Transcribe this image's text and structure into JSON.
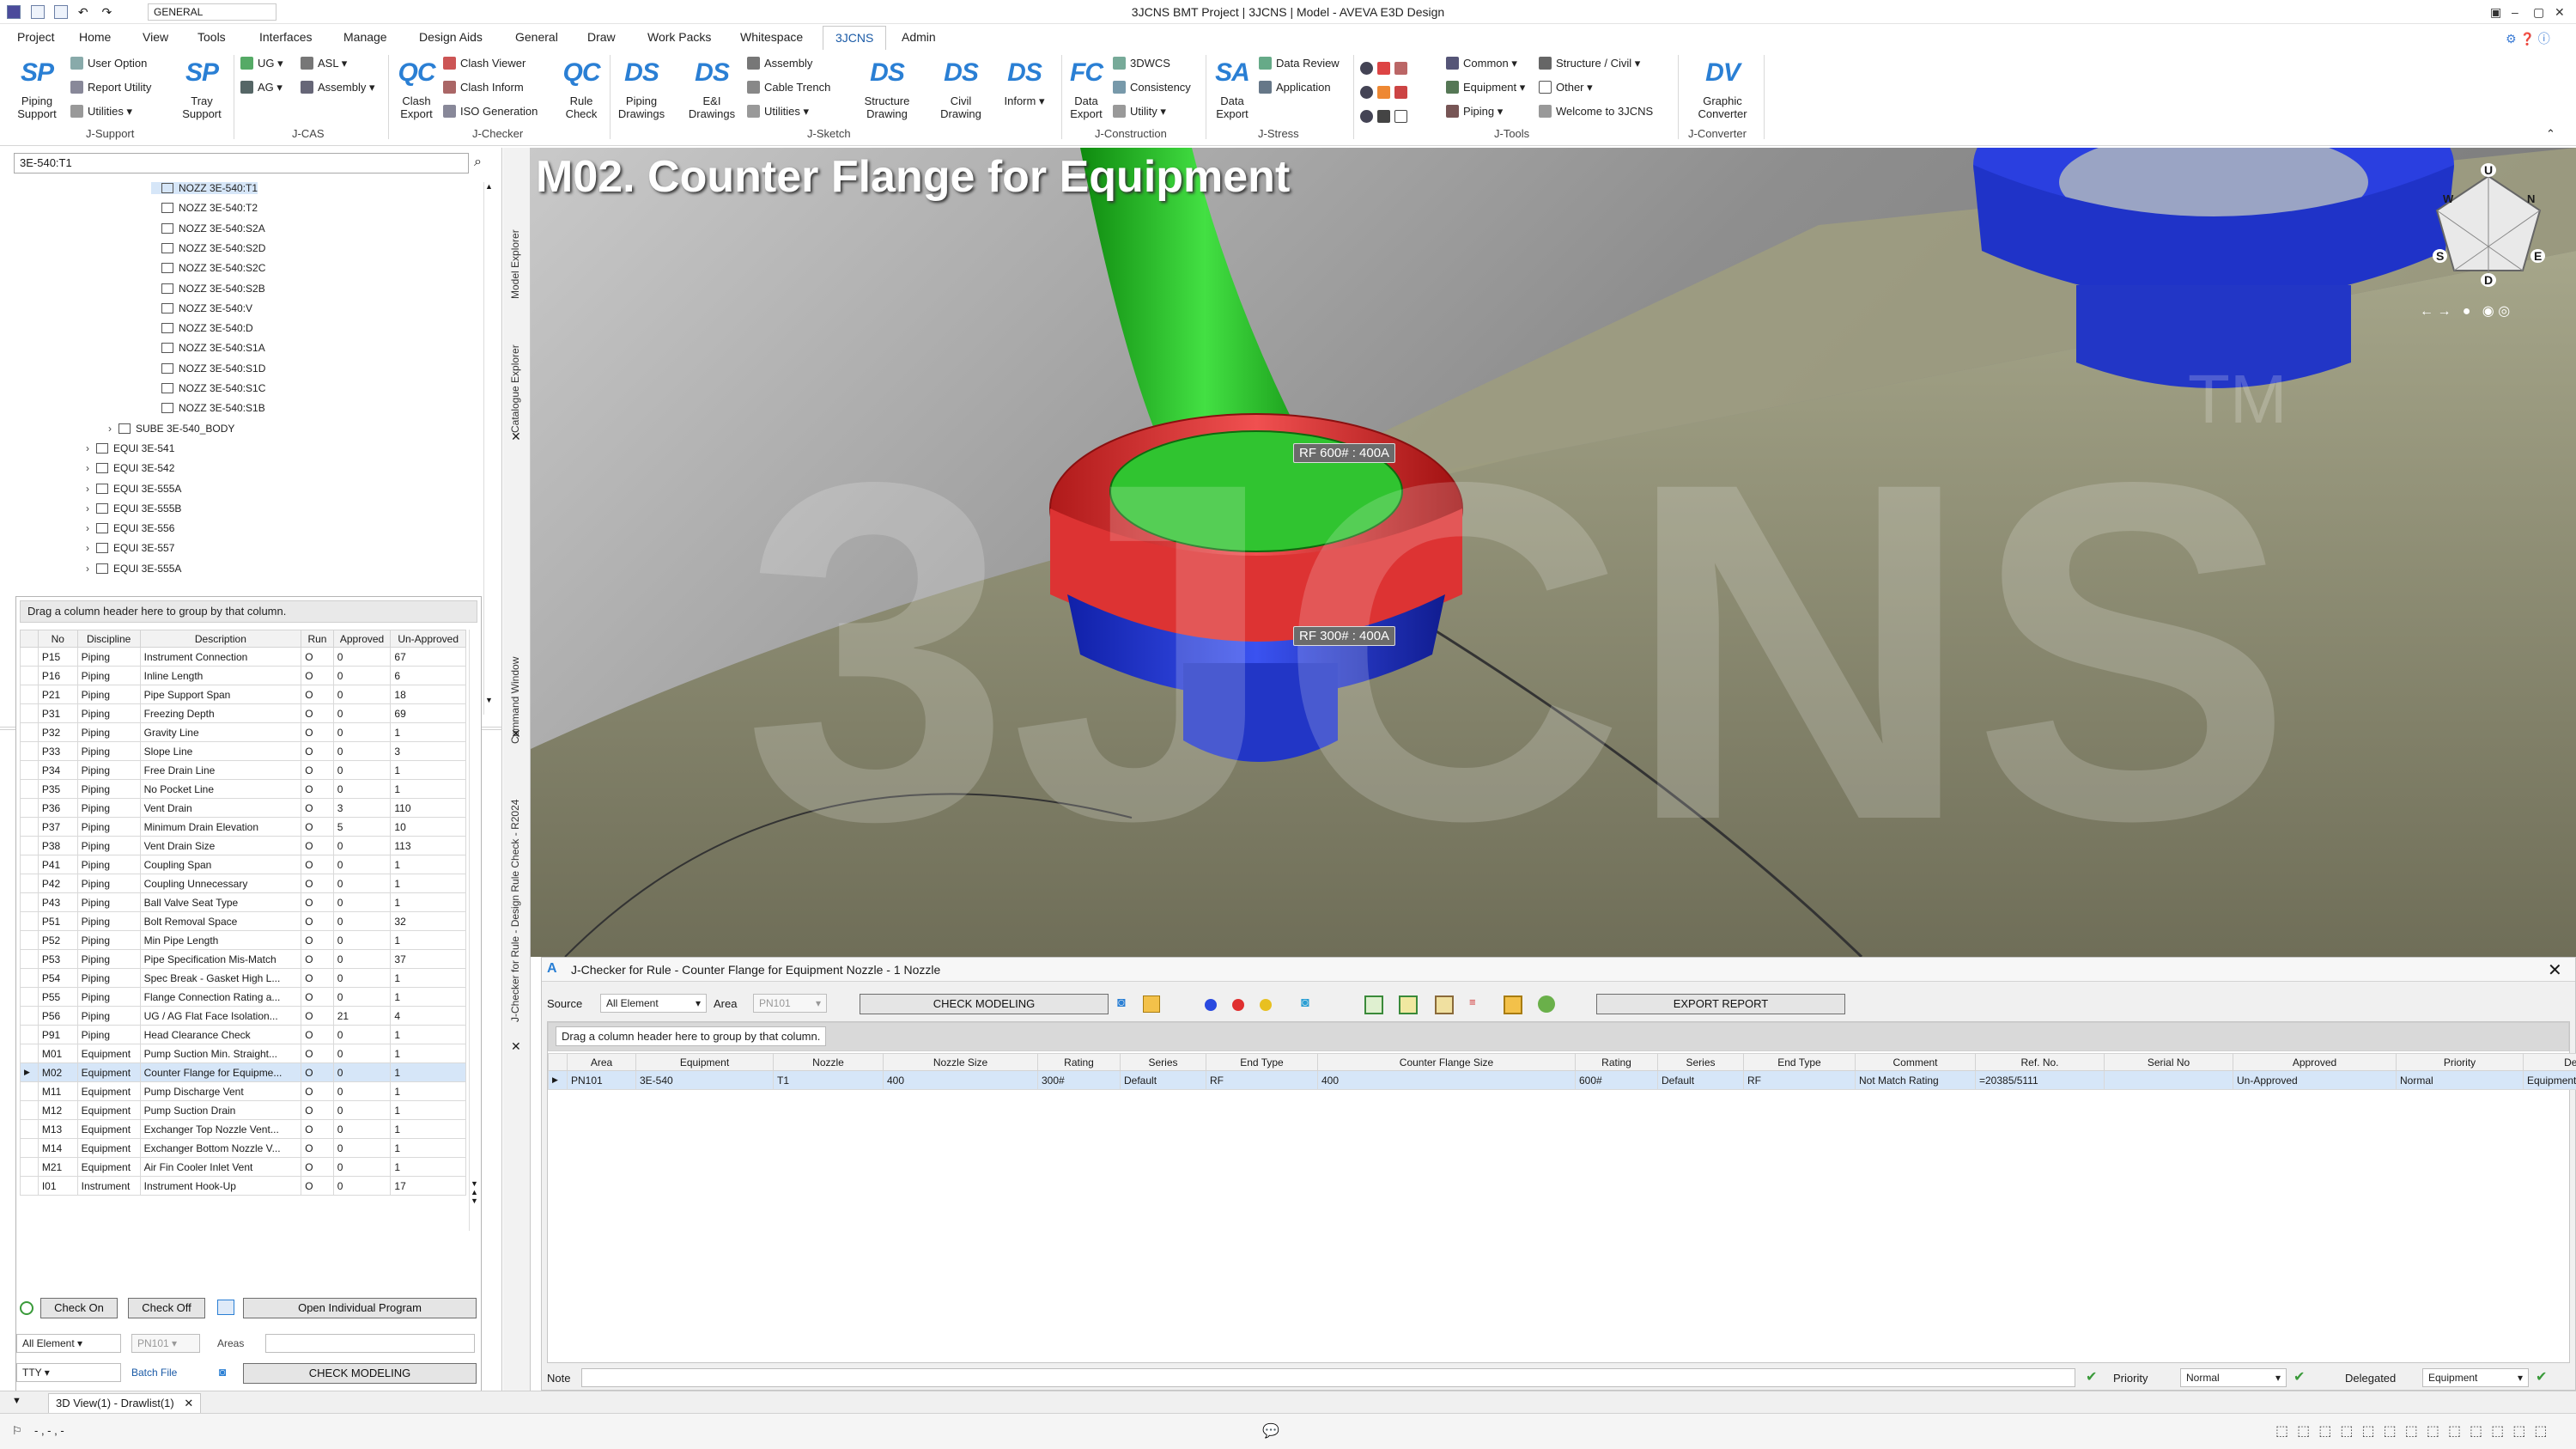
{
  "titlebar": {
    "title": "3JCNS BMT Project | 3JCNS | Model - AVEVA E3D Design",
    "combo_value": "GENERAL"
  },
  "menu": {
    "tabs": [
      "Project",
      "Home",
      "View",
      "Tools",
      "Interfaces",
      "Manage",
      "Design Aids",
      "General",
      "Draw",
      "Work Packs",
      "Whitespace",
      "3JCNS",
      "Admin"
    ],
    "active": "3JCNS"
  },
  "ribbon": {
    "big_buttons": [
      {
        "icon": "SP",
        "label": "Piping\nSupport"
      },
      {
        "icon": "SP",
        "label": "Tray\nSupport"
      },
      {
        "icon": "QC",
        "label": "Clash\nExport"
      },
      {
        "icon": "QC",
        "label": "Rule\nCheck"
      },
      {
        "icon": "DS",
        "label": "Piping\nDrawings"
      },
      {
        "icon": "DS",
        "label": "E&I\nDrawings"
      },
      {
        "icon": "DS",
        "label": "Structure\nDrawing"
      },
      {
        "icon": "DS",
        "label": "Civil\nDrawing"
      },
      {
        "icon": "DS",
        "label": "Inform"
      },
      {
        "icon": "FC",
        "label": "Data\nExport"
      },
      {
        "icon": "SA",
        "label": "Data\nExport"
      },
      {
        "icon": "DV",
        "label": "Graphic\nConverter"
      }
    ],
    "small_items": {
      "jsupport": [
        "User Option",
        "Report Utility",
        "Utilities"
      ],
      "jcas": [
        "UG",
        "AG",
        "ASL",
        "Assembly"
      ],
      "jchecker": [
        "Clash Viewer",
        "Clash Inform",
        "ISO Generation"
      ],
      "jsketch": [
        "Assembly",
        "Cable Trench",
        "Utilities"
      ],
      "jconstruction": [
        "3DWCS",
        "Consistency",
        "Utility"
      ],
      "jstress": [
        "Data Review",
        "Application"
      ],
      "jtools": [
        "Common",
        "Equipment",
        "Piping",
        "Structure / Civil",
        "Other",
        "Welcome to 3JCNS"
      ]
    },
    "groups": [
      "J-Support",
      "J-CAS",
      "J-Checker",
      "J-Sketch",
      "J-Construction",
      "J-Stress",
      "J-Tools",
      "J-Converter"
    ]
  },
  "explorer": {
    "search_value": "3E-540:T1",
    "nozzles": [
      "NOZZ 3E-540:T1",
      "NOZZ 3E-540:T2",
      "NOZZ 3E-540:S2A",
      "NOZZ 3E-540:S2D",
      "NOZZ 3E-540:S2C",
      "NOZZ 3E-540:S2B",
      "NOZZ 3E-540:V",
      "NOZZ 3E-540:D",
      "NOZZ 3E-540:S1A",
      "NOZZ 3E-540:S1D",
      "NOZZ 3E-540:S1C",
      "NOZZ 3E-540:S1B"
    ],
    "subequip": "SUBE 3E-540_BODY",
    "equips": [
      "EQUI 3E-541",
      "EQUI 3E-542",
      "EQUI 3E-555A",
      "EQUI 3E-555B",
      "EQUI 3E-556",
      "EQUI 3E-557",
      "EQUI 3E-555A"
    ],
    "vtabs": [
      "Model Explorer",
      "Catalogue Explorer"
    ]
  },
  "rules": {
    "group_hint": "Drag a column header here to group by that column.",
    "columns": [
      "No",
      "Discipline",
      "Description",
      "Run",
      "Approved",
      "Un-Approved"
    ],
    "rows": [
      [
        "P15",
        "Piping",
        "Instrument Connection",
        "O",
        "0",
        "67"
      ],
      [
        "P16",
        "Piping",
        "Inline Length",
        "O",
        "0",
        "6"
      ],
      [
        "P21",
        "Piping",
        "Pipe Support Span",
        "O",
        "0",
        "18"
      ],
      [
        "P31",
        "Piping",
        "Freezing Depth",
        "O",
        "0",
        "69"
      ],
      [
        "P32",
        "Piping",
        "Gravity Line",
        "O",
        "0",
        "1"
      ],
      [
        "P33",
        "Piping",
        "Slope Line",
        "O",
        "0",
        "3"
      ],
      [
        "P34",
        "Piping",
        "Free Drain Line",
        "O",
        "0",
        "1"
      ],
      [
        "P35",
        "Piping",
        "No Pocket Line",
        "O",
        "0",
        "1"
      ],
      [
        "P36",
        "Piping",
        "Vent Drain",
        "O",
        "3",
        "110"
      ],
      [
        "P37",
        "Piping",
        "Minimum Drain Elevation",
        "O",
        "5",
        "10"
      ],
      [
        "P38",
        "Piping",
        "Vent Drain Size",
        "O",
        "0",
        "113"
      ],
      [
        "P41",
        "Piping",
        "Coupling Span",
        "O",
        "0",
        "1"
      ],
      [
        "P42",
        "Piping",
        "Coupling Unnecessary",
        "O",
        "0",
        "1"
      ],
      [
        "P43",
        "Piping",
        "Ball Valve Seat Type",
        "O",
        "0",
        "1"
      ],
      [
        "P51",
        "Piping",
        "Bolt Removal Space",
        "O",
        "0",
        "32"
      ],
      [
        "P52",
        "Piping",
        "Min Pipe Length",
        "O",
        "0",
        "1"
      ],
      [
        "P53",
        "Piping",
        "Pipe Specification Mis-Match",
        "O",
        "0",
        "37"
      ],
      [
        "P54",
        "Piping",
        "Spec Break - Gasket High L...",
        "O",
        "0",
        "1"
      ],
      [
        "P55",
        "Piping",
        "Flange Connection Rating a...",
        "O",
        "0",
        "1"
      ],
      [
        "P56",
        "Piping",
        "UG / AG Flat Face Isolation...",
        "O",
        "21",
        "4"
      ],
      [
        "P91",
        "Piping",
        "Head Clearance Check",
        "O",
        "0",
        "1"
      ],
      [
        "M01",
        "Equipment",
        "Pump Suction Min. Straight...",
        "O",
        "0",
        "1"
      ],
      [
        "M02",
        "Equipment",
        "Counter Flange for Equipme...",
        "O",
        "0",
        "1"
      ],
      [
        "M11",
        "Equipment",
        "Pump Discharge Vent",
        "O",
        "0",
        "1"
      ],
      [
        "M12",
        "Equipment",
        "Pump Suction Drain",
        "O",
        "0",
        "1"
      ],
      [
        "M13",
        "Equipment",
        "Exchanger Top Nozzle Vent...",
        "O",
        "0",
        "1"
      ],
      [
        "M14",
        "Equipment",
        "Exchanger Bottom Nozzle V...",
        "O",
        "0",
        "1"
      ],
      [
        "M21",
        "Equipment",
        "Air Fin Cooler Inlet Vent",
        "O",
        "0",
        "1"
      ],
      [
        "I01",
        "Instrument",
        "Instrument Hook-Up",
        "O",
        "0",
        "17"
      ]
    ],
    "selected_index": 22,
    "check_on": "Check On",
    "check_off": "Check Off",
    "open_program": "Open Individual Program",
    "source_value": "All Element",
    "area_value": "PN101",
    "area_label": "Areas",
    "tty_value": "TTY",
    "batch_file": "Batch File",
    "check_modeling": "CHECK MODELING",
    "vtabs": [
      "Command Window",
      "J-Checker for Rule - Design Rule Check - R2024"
    ]
  },
  "viewport": {
    "heading": "M02. Counter Flange for Equipment",
    "tag_top": "RF 600# : 400A",
    "tag_bottom": "RF 300# : 400A",
    "watermark": "3JCNS",
    "compass": [
      "U",
      "W",
      "N",
      "S",
      "E",
      "D"
    ],
    "colors": {
      "pipe": "#1fc21f",
      "flange_red": "#e03030",
      "flange_blue": "#2a3fe0",
      "vessel": "#8b8a72"
    }
  },
  "checker": {
    "title": "J-Checker for Rule - Counter Flange for Equipment Nozzle - 1 Nozzle",
    "source_label": "Source",
    "source_value": "All Element",
    "area_label": "Area",
    "area_value": "PN101",
    "check_modeling": "CHECK MODELING",
    "export_report": "EXPORT REPORT",
    "group_hint": "Drag a column header here to group by that column.",
    "columns": [
      "Area",
      "Equipment",
      "Nozzle",
      "Nozzle Size",
      "Rating",
      "Series",
      "End Type",
      "Counter Flange Size",
      "Rating",
      "Series",
      "End Type",
      "Comment",
      "Ref. No.",
      "Serial No",
      "Approved",
      "Priority",
      "Delegated"
    ],
    "row": [
      "PN101",
      "3E-540",
      "T1",
      "400",
      "300#",
      "Default",
      "RF",
      "400",
      "600#",
      "Default",
      "RF",
      "Not Match Rating",
      "=20385/5111",
      "",
      "Un-Approved",
      "Normal",
      "Equipment"
    ],
    "note_label": "Note",
    "priority_label": "Priority",
    "priority_value": "Normal",
    "delegated_label": "Delegated",
    "delegated_value": "Equipment"
  },
  "bottom": {
    "tab": "3D View(1) - Drawlist(1)",
    "status": "- , - , -"
  }
}
